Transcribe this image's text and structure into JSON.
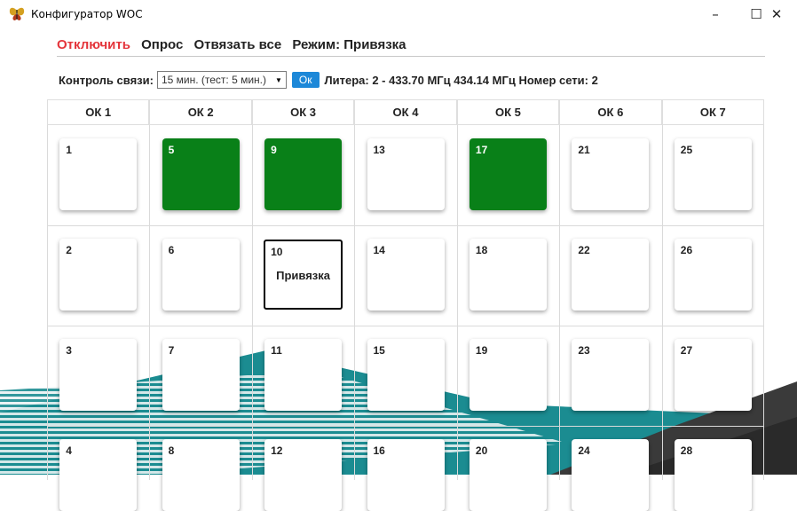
{
  "window": {
    "title": "Конфигуратор WOC",
    "minimize_glyph": "–",
    "maximize_glyph": "☐",
    "close_glyph": "✕",
    "app_icon": "butterfly-icon"
  },
  "menu": {
    "disconnect": "Отключить",
    "poll": "Опрос",
    "unbind_all": "Отвязать все",
    "mode": "Режим: Привязка"
  },
  "control": {
    "label": "Контроль связи:",
    "select_value": "15 мин. (тест: 5 мин.)",
    "ok": "Ок",
    "info": "Литера: 2 - 433.70 МГц 434.14 МГц Номер сети: 2"
  },
  "columns": [
    "ОК 1",
    "ОК 2",
    "ОК 3",
    "ОК 4",
    "ОК 5",
    "ОК 6",
    "ОК 7"
  ],
  "cells": [
    {
      "number": "1",
      "state": "inactive"
    },
    {
      "number": "5",
      "state": "active"
    },
    {
      "number": "9",
      "state": "active"
    },
    {
      "number": "13",
      "state": "inactive"
    },
    {
      "number": "17",
      "state": "active"
    },
    {
      "number": "21",
      "state": "inactive"
    },
    {
      "number": "25",
      "state": "inactive"
    },
    {
      "number": "2",
      "state": "inactive"
    },
    {
      "number": "6",
      "state": "inactive"
    },
    {
      "number": "10",
      "state": "selected",
      "sub": "Привязка"
    },
    {
      "number": "14",
      "state": "inactive"
    },
    {
      "number": "18",
      "state": "inactive"
    },
    {
      "number": "22",
      "state": "inactive"
    },
    {
      "number": "26",
      "state": "inactive"
    },
    {
      "number": "3",
      "state": "inactive"
    },
    {
      "number": "7",
      "state": "inactive"
    },
    {
      "number": "11",
      "state": "inactive"
    },
    {
      "number": "15",
      "state": "inactive"
    },
    {
      "number": "19",
      "state": "inactive"
    },
    {
      "number": "23",
      "state": "inactive"
    },
    {
      "number": "27",
      "state": "inactive"
    },
    {
      "number": "4",
      "state": "inactive"
    },
    {
      "number": "8",
      "state": "inactive"
    },
    {
      "number": "12",
      "state": "inactive"
    },
    {
      "number": "16",
      "state": "inactive"
    },
    {
      "number": "20",
      "state": "inactive"
    },
    {
      "number": "24",
      "state": "inactive"
    },
    {
      "number": "28",
      "state": "inactive"
    }
  ],
  "colors": {
    "active_green": "#098018",
    "disconnect_red": "#e4353b",
    "ok_blue": "#1d88d8",
    "deco_teal": "#1b8c91",
    "deco_dark": "#3a3a3a"
  }
}
